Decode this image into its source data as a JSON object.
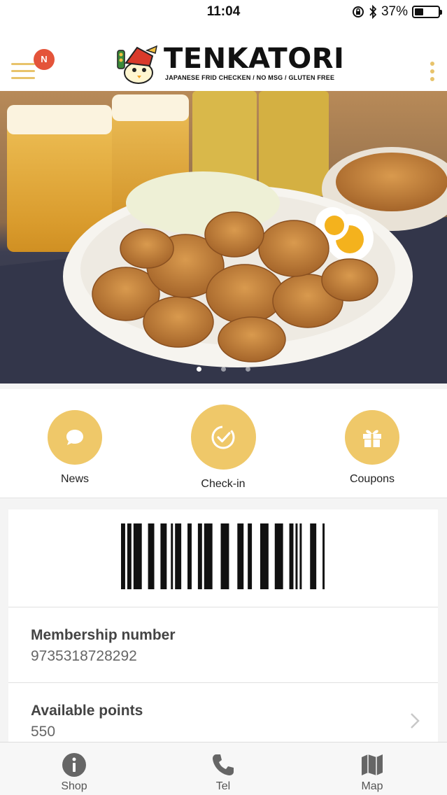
{
  "status_bar": {
    "time": "11:04",
    "battery_percent": "37%",
    "battery_level": 0.37
  },
  "header": {
    "notification_badge": "N",
    "logo_title": "TENKATORI",
    "logo_tagline": "JAPANESE FRID CHECKEN / NO MSG / GLUTEN FREE"
  },
  "hero": {
    "slides": 3,
    "active_slide": 1
  },
  "actions": {
    "news_label": "News",
    "checkin_label": "Check-in",
    "coupons_label": "Coupons"
  },
  "member": {
    "membership_label": "Membership number",
    "membership_value": "9735318728292",
    "points_label": "Available points",
    "points_value": "550"
  },
  "tabbar": {
    "shop_label": "Shop",
    "tel_label": "Tel",
    "map_label": "Map"
  },
  "colors": {
    "accent": "#efc869",
    "badge": "#e4543a"
  }
}
